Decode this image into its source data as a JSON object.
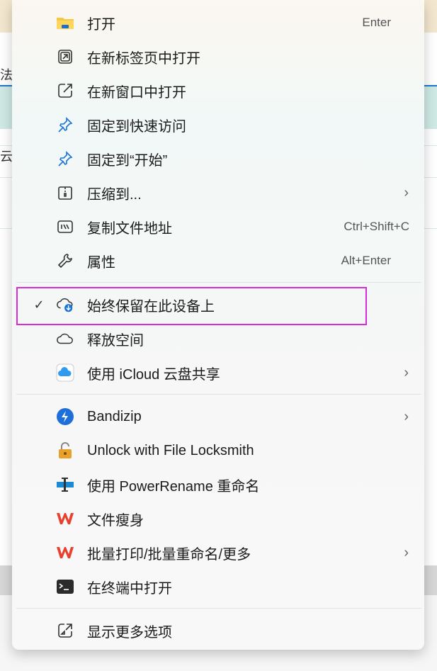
{
  "background": {
    "left_text_1": "法",
    "left_text_2": "云"
  },
  "menu": {
    "items": [
      {
        "label": "打开",
        "shortcut": "Enter",
        "icon": "folder-icon"
      },
      {
        "label": "在新标签页中打开",
        "icon": "new-tab-icon"
      },
      {
        "label": "在新窗口中打开",
        "icon": "new-window-icon"
      },
      {
        "label": "固定到快速访问",
        "icon": "pin-icon"
      },
      {
        "label": "固定到“开始”",
        "icon": "pin-icon"
      },
      {
        "label": "压缩到...",
        "icon": "zip-icon",
        "submenu": true
      },
      {
        "label": "复制文件地址",
        "shortcut": "Ctrl+Shift+C",
        "icon": "copy-path-icon"
      },
      {
        "label": "属性",
        "shortcut": "Alt+Enter",
        "icon": "wrench-icon"
      },
      {
        "label": "始终保留在此设备上",
        "checked": true,
        "icon": "cloud-download-icon"
      },
      {
        "label": "释放空间",
        "icon": "cloud-outline-icon"
      },
      {
        "label": "使用 iCloud 云盘共享",
        "icon": "icloud-icon",
        "submenu": true
      },
      {
        "label": "Bandizip",
        "icon": "bandizip-icon",
        "submenu": true
      },
      {
        "label": "Unlock with File Locksmith",
        "icon": "lock-icon"
      },
      {
        "label": "使用 PowerRename 重命名",
        "icon": "powerrename-icon"
      },
      {
        "label": "文件瘦身",
        "icon": "wps-icon"
      },
      {
        "label": "批量打印/批量重命名/更多",
        "icon": "wps-icon",
        "submenu": true
      },
      {
        "label": "在终端中打开",
        "icon": "terminal-icon"
      },
      {
        "label": "显示更多选项",
        "icon": "more-options-icon"
      }
    ],
    "check_mark": "✓",
    "chevron": "›"
  },
  "colors": {
    "highlight_border": "#d92bd9",
    "accent_blue": "#1a73d9",
    "wps_red": "#e8402f"
  }
}
